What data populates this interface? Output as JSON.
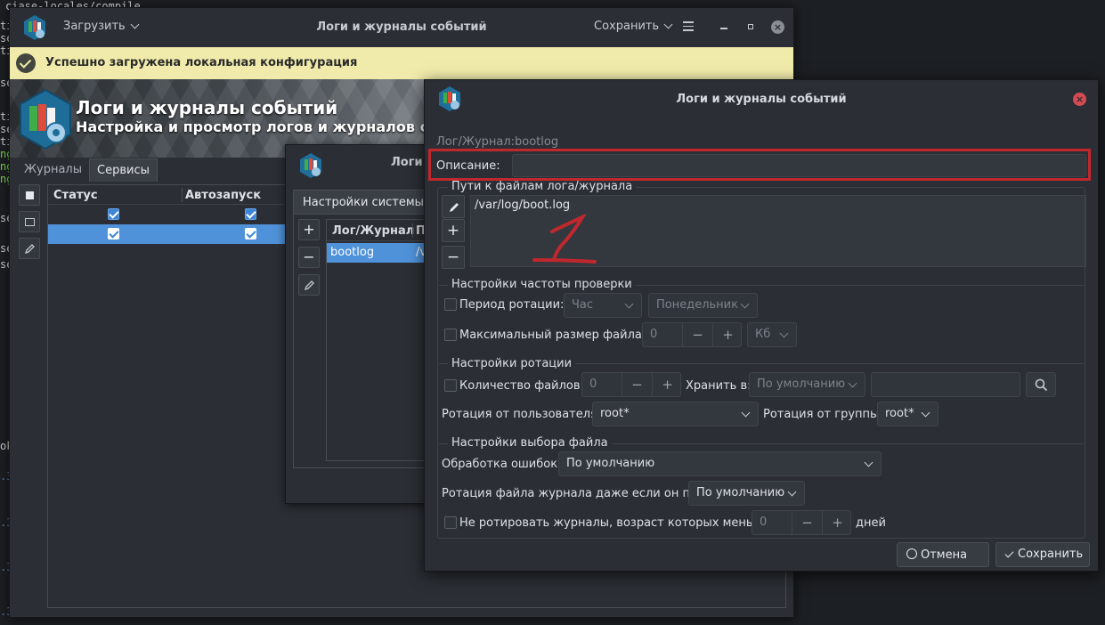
{
  "terminal": {
    "lines": [
      {
        "text": "ciase-locales/compile",
        "color": "normal"
      },
      {
        "text": "ti",
        "color": "normal"
      },
      {
        "text": "se",
        "color": "normal"
      },
      {
        "text": "ti",
        "color": "normal"
      },
      {
        "text": "se",
        "color": "normal"
      },
      {
        "text": "ti",
        "color": "normal"
      },
      {
        "text": "se",
        "color": "normal"
      },
      {
        "text": "ti",
        "color": "normal"
      },
      {
        "text": "ng",
        "color": "green"
      },
      {
        "text": "ng",
        "color": "green"
      },
      {
        "text": "ng",
        "color": "green"
      },
      {
        "text": "se",
        "color": "normal"
      },
      {
        "text": "se",
        "color": "normal"
      },
      {
        "text": "se",
        "color": "normal"
      },
      {
        "text": "ok",
        "color": "normal"
      },
      {
        "text": ".3",
        "color": "blue"
      },
      {
        "text": ".3",
        "color": "blue"
      },
      {
        "text": ".3",
        "color": "blue"
      },
      {
        "text": ".3",
        "color": "blue"
      }
    ]
  },
  "main_window": {
    "title": "Логи и журналы событий",
    "load_menu": "Загрузить",
    "save_menu": "Сохранить",
    "notification": "Успешно загружена локальная конфигурация",
    "banner_title": "Логи и журналы событий",
    "banner_subtitle": "Настройка и просмотр логов и журналов событий",
    "tabs": [
      {
        "label": "Журналы",
        "active": false
      },
      {
        "label": "Сервисы",
        "active": true
      }
    ],
    "table": {
      "columns": [
        "Статус",
        "Автозапуск"
      ],
      "rows": [
        {
          "status": true,
          "autostart": true,
          "selected": false
        },
        {
          "status": true,
          "autostart": true,
          "selected": true
        }
      ]
    }
  },
  "middle_window": {
    "title": "Логи",
    "tab": "Настройки системы",
    "columns": [
      "Лог/Журнал",
      "П"
    ],
    "rows": [
      {
        "name": "bootlog",
        "path": "/v"
      }
    ]
  },
  "dialog": {
    "title": "Логи и журналы событий",
    "log_label": "Лог/Журнал:",
    "log_value": "bootlog",
    "description_label": "Описание:",
    "description_value": "",
    "paths_title": "Пути к файлам лога/журнала",
    "paths": [
      "/var/log/boot.log"
    ],
    "freq_title": "Настройки частоты проверки",
    "rotation_period_label": "Период ротации:",
    "rotation_period_value": "Час",
    "weekday_value": "Понедельник",
    "max_size_label": "Максимальный размер файла:",
    "max_size_value": "0",
    "size_unit": "Кб",
    "rotation_title": "Настройки ротации",
    "file_count_label": "Количество файлов:",
    "file_count_value": "0",
    "keep_in_label": "Хранить в:",
    "keep_in_value": "По умолчанию",
    "rotate_user_label": "Ротация от пользователя:",
    "rotate_user_value": "root*",
    "rotate_group_label": "Ротация от группы:",
    "rotate_group_value": "root*",
    "file_select_title": "Настройки выбора файла",
    "errors_label": "Обработка ошибок:",
    "errors_value": "По умолчанию",
    "empty_label": "Ротация файла журнала даже если он пуст:",
    "empty_value": "По умолчанию",
    "no_rotate_label": "Не ротировать журналы, возраст которых меньше",
    "no_rotate_value": "0",
    "days_label": "дней",
    "cancel": "Отмена",
    "save": "Сохранить"
  },
  "colors": {
    "accent": "#4f92d9",
    "highlight": "#c0282d",
    "notification_bg": "#f1ebab"
  },
  "icons": [
    "app-logo-icon",
    "check-circle-icon",
    "hamburger-icon",
    "minimize-icon",
    "maximize-icon",
    "close-icon",
    "pencil-icon",
    "plus-icon",
    "minus-icon",
    "search-icon",
    "chevron-down-icon",
    "cancel-icon",
    "check-icon"
  ]
}
